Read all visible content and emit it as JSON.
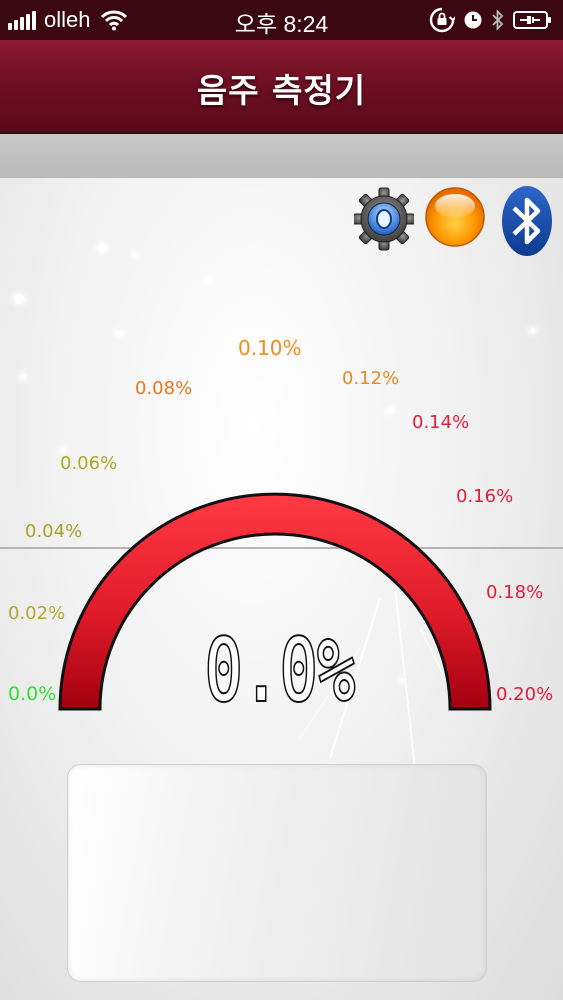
{
  "status_bar": {
    "carrier": "olleh",
    "time": "오후 8:24",
    "icons": [
      "signal-icon",
      "wifi-icon",
      "rotation-lock-icon",
      "alarm-icon",
      "bluetooth-icon",
      "battery-charging-icon"
    ]
  },
  "header": {
    "title": "음주 측정기"
  },
  "toolbar": {
    "icons": [
      "settings-gear-icon",
      "orange-status-light-icon",
      "bluetooth-icon"
    ]
  },
  "gauge": {
    "ticks": [
      {
        "label": "0.0%",
        "color": "#33dd33"
      },
      {
        "label": "0.02%",
        "color": "#b5a92a"
      },
      {
        "label": "0.04%",
        "color": "#a8a227"
      },
      {
        "label": "0.06%",
        "color": "#a8ac22"
      },
      {
        "label": "0.08%",
        "color": "#e3771f"
      },
      {
        "label": "0.10%",
        "color": "#f08d23"
      },
      {
        "label": "0.12%",
        "color": "#e88a23"
      },
      {
        "label": "0.14%",
        "color": "#e0203a"
      },
      {
        "label": "0.16%",
        "color": "#e21d3c"
      },
      {
        "label": "0.18%",
        "color": "#e21d3c"
      },
      {
        "label": "0.20%",
        "color": "#e31a3a"
      }
    ],
    "value": "0.0%",
    "arc_color": "#e01b2a"
  }
}
